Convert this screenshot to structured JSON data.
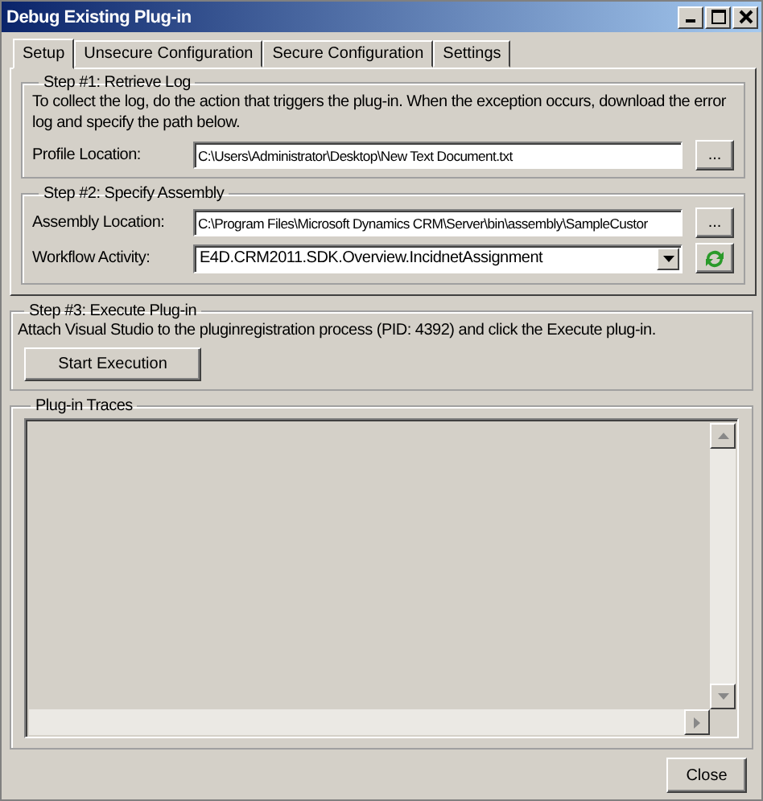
{
  "window": {
    "title": "Debug Existing Plug-in"
  },
  "tabs": [
    {
      "label": "Setup",
      "selected": true
    },
    {
      "label": "Unsecure Configuration",
      "selected": false
    },
    {
      "label": "Secure Configuration",
      "selected": false
    },
    {
      "label": "Settings",
      "selected": false
    }
  ],
  "step1": {
    "title": "Step #1: Retrieve Log",
    "description": "To collect the log, do the action that triggers the plug-in. When the exception occurs, download the error log and specify the path below.",
    "profile_label": "Profile Location:",
    "profile_value": "C:\\Users\\Administrator\\Desktop\\New Text Document.txt",
    "browse_button": "..."
  },
  "step2": {
    "title": "Step #2: Specify Assembly",
    "assembly_label": "Assembly Location:",
    "assembly_value": "C:\\Program Files\\Microsoft Dynamics CRM\\Server\\bin\\assembly\\SampleCustor",
    "browse_button": "...",
    "workflow_label": "Workflow Activity:",
    "workflow_value": "E4D.CRM2011.SDK.Overview.IncidnetAssignment"
  },
  "step3": {
    "title": "Step #3: Execute Plug-in",
    "description": "Attach Visual Studio to the pluginregistration process (PID: 4392) and click the Execute plug-in.",
    "button": "Start Execution"
  },
  "traces": {
    "title": "Plug-in Traces"
  },
  "close_button": "Close"
}
